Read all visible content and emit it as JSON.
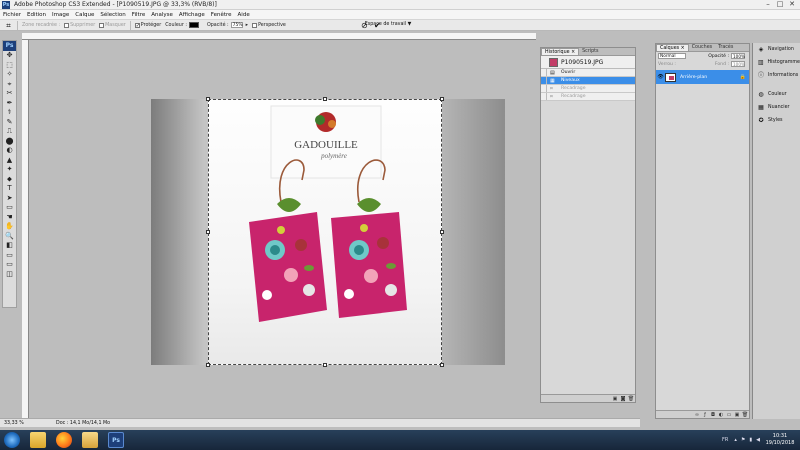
{
  "window": {
    "title": "Adobe Photoshop CS3 Extended - [P1090519.JPG @ 33,3% (RVB/8)]",
    "logo": "Ps",
    "controls": [
      "–",
      "□",
      "✕"
    ]
  },
  "menu": [
    "Fichier",
    "Edition",
    "Image",
    "Calque",
    "Sélection",
    "Filtre",
    "Analyse",
    "Affichage",
    "Fenêtre",
    "Aide"
  ],
  "options_bar": {
    "zone": "Zone recadrée :",
    "supprimer": "Supprimer",
    "masquer": "Masquer",
    "proteger": "Protéger",
    "couleur": "Couleur :",
    "opacite_label": "Opacité :",
    "opacite_value": "75%",
    "perspective": "Perspective",
    "workspace": "Espace de travail ▼",
    "shield_color": "#000000"
  },
  "toolbox": {
    "logo": "Ps",
    "tools": [
      "✥",
      "⬚",
      "✧",
      "⌖",
      "✂",
      "✒",
      "⚕",
      "✎",
      "⎍",
      "⬤",
      "◐",
      "▲",
      "✦",
      "⬥",
      "T",
      "➤",
      "▭",
      "☚",
      "✋",
      "🔍",
      "◧",
      "▭",
      "▭",
      "◫"
    ]
  },
  "status": {
    "zoom": "33,33 %",
    "doc": "Doc : 14,1 Mo/14,1 Mo"
  },
  "history_panel": {
    "tabs": [
      "Historique ×",
      "Scripts"
    ],
    "snapshot": "P1090519.JPG",
    "steps": [
      {
        "label": "Ouvrir",
        "state": "normal"
      },
      {
        "label": "Niveaux",
        "state": "selected"
      },
      {
        "label": "Recadrage",
        "state": "grey"
      },
      {
        "label": "Recadrage",
        "state": "grey"
      }
    ]
  },
  "layers_panel": {
    "tabs": [
      "Calques ×",
      "Couches",
      "Tracés"
    ],
    "mode": "Normal",
    "opacity_label": "Opacité :",
    "opacity_value": "100%",
    "lock_label": "Verrou :",
    "fill_label": "Fond :",
    "fill_value": "100%",
    "layer_name": "Arrière-plan"
  },
  "dock": {
    "group1": [
      {
        "icon": "navigator-icon",
        "glyph": "◈",
        "label": "Navigation"
      },
      {
        "icon": "histogram-icon",
        "glyph": "▥",
        "label": "Histogramme"
      },
      {
        "icon": "info-icon",
        "glyph": "ⓘ",
        "label": "Informations"
      }
    ],
    "group2": [
      {
        "icon": "color-icon",
        "glyph": "◍",
        "label": "Couleur"
      },
      {
        "icon": "swatches-icon",
        "glyph": "▦",
        "label": "Nuancier"
      },
      {
        "icon": "styles-icon",
        "glyph": "✪",
        "label": "Styles"
      }
    ]
  },
  "taskbar": {
    "tray": "FR",
    "time": "10:31",
    "date": "19/10/2018"
  },
  "image": {
    "card_line1": "GADOUILLE",
    "card_line2": "polymère",
    "accent_magenta": "#c8246c",
    "accent_green": "#5a8f2e"
  }
}
